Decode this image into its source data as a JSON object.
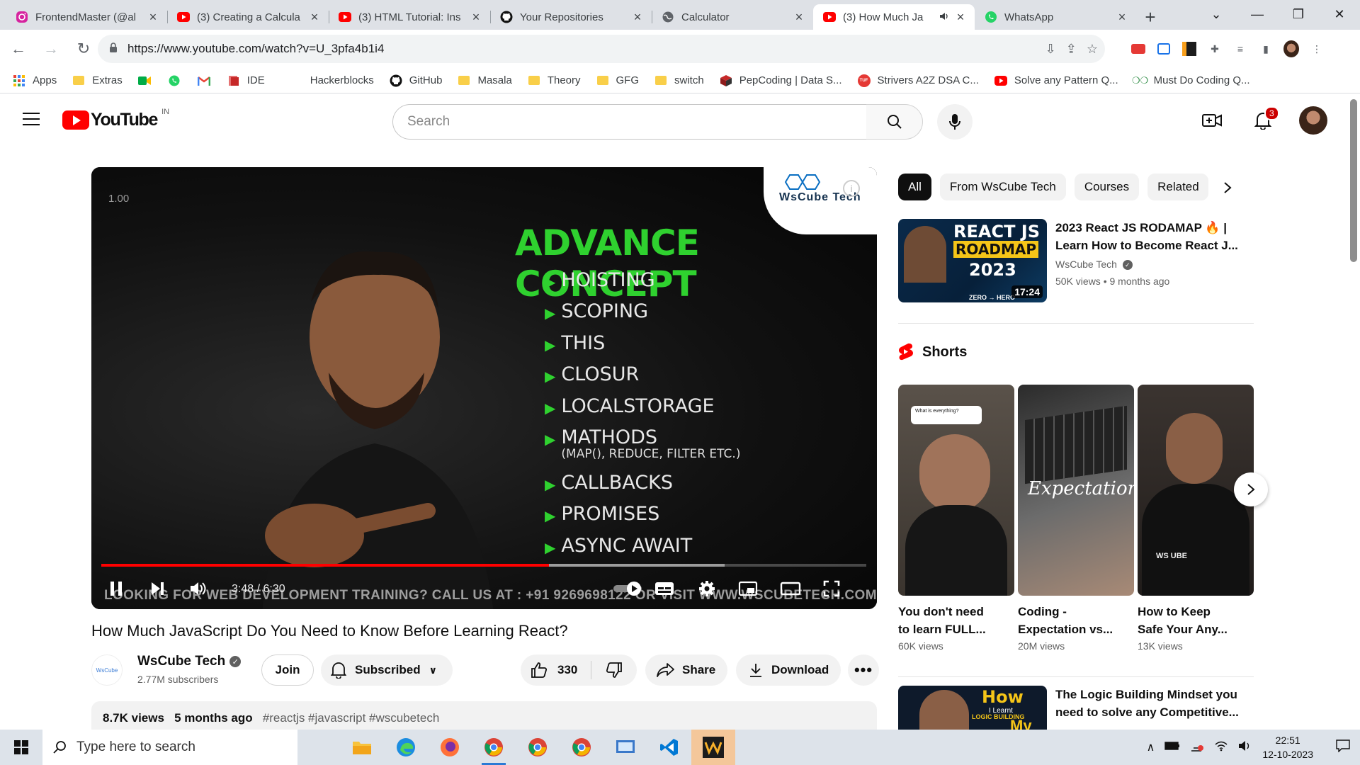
{
  "tabs": [
    {
      "title": "FrontendMaster (@al",
      "icon": "instagram-icon",
      "color": "#d6249f"
    },
    {
      "title": "(3) Creating a Calcula",
      "icon": "youtube-icon",
      "color": "#ff0000"
    },
    {
      "title": "(3) HTML Tutorial: Ins",
      "icon": "youtube-icon",
      "color": "#ff0000"
    },
    {
      "title": "Your Repositories",
      "icon": "github-icon",
      "color": "#111111"
    },
    {
      "title": "Calculator",
      "icon": "globe-icon",
      "color": "#5f6368"
    },
    {
      "title": "(3) How Much Ja",
      "icon": "youtube-icon",
      "color": "#ff0000",
      "active": true
    },
    {
      "title": "WhatsApp",
      "icon": "whatsapp-icon",
      "color": "#25d366"
    }
  ],
  "address": {
    "url": "https://www.youtube.com/watch?v=U_3pfa4b1i4"
  },
  "bookmarks": [
    {
      "label": "Apps",
      "icon": "apps-grid-icon"
    },
    {
      "label": "Extras",
      "icon": "folder-icon"
    },
    {
      "label": "",
      "icon": "meet-icon"
    },
    {
      "label": "",
      "icon": "whatsapp-icon"
    },
    {
      "label": "",
      "icon": "gmail-icon"
    },
    {
      "label": "IDE",
      "icon": "ide-icon"
    },
    {
      "label": "Hackerblocks",
      "icon": "blank-icon"
    },
    {
      "label": "GitHub",
      "icon": "github-icon"
    },
    {
      "label": "Masala",
      "icon": "folder-icon"
    },
    {
      "label": "Theory",
      "icon": "folder-icon"
    },
    {
      "label": "GFG",
      "icon": "folder-icon"
    },
    {
      "label": "switch",
      "icon": "folder-icon"
    },
    {
      "label": "PepCoding | Data S...",
      "icon": "pepcoding-icon"
    },
    {
      "label": "Strivers A2Z DSA C...",
      "icon": "tuf-icon"
    },
    {
      "label": "Solve any Pattern Q...",
      "icon": "youtube-icon"
    },
    {
      "label": "Must Do Coding Q...",
      "icon": "gfg-icon"
    }
  ],
  "youtube": {
    "logo_text": "YouTube",
    "country": "IN",
    "search_placeholder": "Search",
    "notification_count": "3"
  },
  "player": {
    "speed_label": "1.00",
    "brand_watermark": "WsCube Tech",
    "slide_title": "ADVANCE CONCEPT",
    "topics": [
      {
        "label": "HOISTING"
      },
      {
        "label": "SCOPING"
      },
      {
        "label": "THIS"
      },
      {
        "label": "CLOSUR"
      },
      {
        "label": "LOCALSTORAGE"
      },
      {
        "label": "MATHODS",
        "sub": "(MAP(), REDUCE, FILTER ETC.)"
      },
      {
        "label": "CALLBACKS"
      },
      {
        "label": "PROMISES"
      },
      {
        "label": "ASYNC AWAIT"
      }
    ],
    "marquee": "LOOKING FOR WEB DEVELOPMENT TRAINING? CALL US AT : +91 9269698122 OR VISIT WWW.WSCUBETECH.COM",
    "time": "3:48 / 6:30",
    "progress_played": 0.585,
    "progress_buffered": 0.815
  },
  "video": {
    "title": "How Much JavaScript Do You Need to Know Before Learning React?",
    "channel": "WsCube Tech",
    "subscribers": "2.77M subscribers",
    "join": "Join",
    "subscribed": "Subscribed",
    "likes": "330",
    "share": "Share",
    "download": "Download",
    "views": "8.7K views",
    "age": "5 months ago",
    "tags": "#reactjs #javascript #wscubetech"
  },
  "chips": [
    "All",
    "From WsCube Tech",
    "Courses",
    "Related"
  ],
  "recommended": [
    {
      "title": "2023 React JS RODAMAP 🔥 | Learn How to Become React J...",
      "channel": "WsCube Tech",
      "meta": "50K views  • 9 months ago",
      "duration": "17:24",
      "thumb_text_1": "REACT JS",
      "thumb_text_2": "ROADMAP",
      "thumb_text_3": "2023",
      "thumb_text_4": "ZERO → HERO"
    },
    {
      "title": "The Logic Building Mindset you need to solve any Competitive...",
      "thumb_text_1": "How",
      "thumb_text_2": "I Learnt",
      "thumb_text_3": "LOGIC BUILDING",
      "thumb_text_4": "My"
    }
  ],
  "shorts": {
    "heading": "Shorts",
    "items": [
      {
        "title_1": "You don't need",
        "title_2": "to learn FULL...",
        "views": "60K views",
        "overlay": "What is everything?"
      },
      {
        "title_1": "Coding -",
        "title_2": "Expectation vs...",
        "views": "20M views",
        "overlay": "Expectation"
      },
      {
        "title_1": "How to Keep",
        "title_2": "Safe Your Any...",
        "views": "13K views",
        "overlay": "WS UBE"
      }
    ]
  },
  "taskbar": {
    "search_placeholder": "Type here to search",
    "time": "22:51",
    "date": "12-10-2023"
  },
  "colors": {
    "youtube_red": "#ff0000",
    "slide_green": "#2fd12f",
    "chrome_frame": "#dee1e6"
  }
}
